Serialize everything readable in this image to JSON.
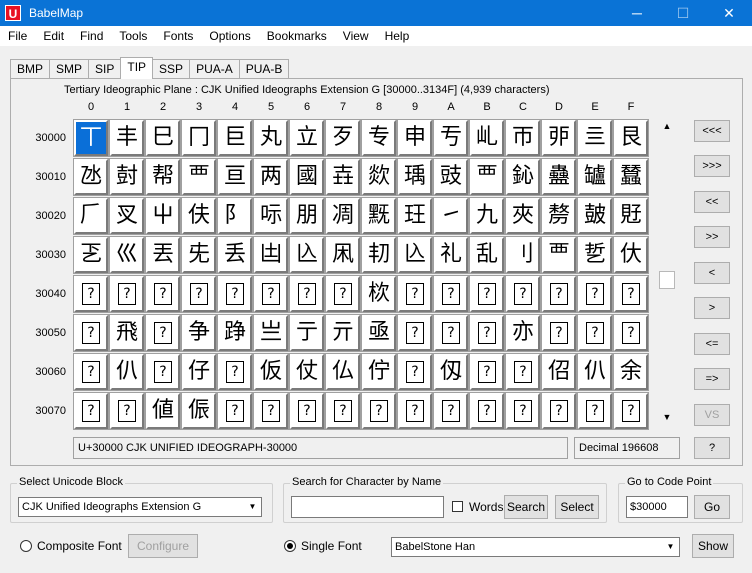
{
  "window": {
    "title": "BabelMap",
    "icon_letter": "U"
  },
  "window_controls": {
    "minimize": "─",
    "maximize": "☐",
    "close": "✕"
  },
  "menu": [
    "File",
    "Edit",
    "Find",
    "Tools",
    "Fonts",
    "Options",
    "Bookmarks",
    "View",
    "Help"
  ],
  "tabs": [
    "BMP",
    "SMP",
    "SIP",
    "TIP",
    "SSP",
    "PUA-A",
    "PUA-B"
  ],
  "active_tab": "TIP",
  "plane_title": "Tertiary Ideographic Plane : CJK Unified Ideographs Extension G [30000..3134F] (4,939 characters)",
  "grid": {
    "columns": [
      "0",
      "1",
      "2",
      "3",
      "4",
      "5",
      "6",
      "7",
      "8",
      "9",
      "A",
      "B",
      "C",
      "D",
      "E",
      "F"
    ],
    "rows": [
      {
        "label": "30000",
        "chars": [
          "丅",
          "丰",
          "巳",
          "冂",
          "巨",
          "丸",
          "立",
          "歹",
          "专",
          "申",
          "亐",
          "乢",
          "帀",
          "戼",
          "亖",
          "艮"
        ]
      },
      {
        "label": "30010",
        "chars": [
          "氹",
          "尌",
          "帮",
          "覀",
          "亘",
          "两",
          "國",
          "壵",
          "欻",
          "瑀",
          "豉",
          "覀",
          "鈊",
          "蠱",
          "罏",
          "蠺"
        ]
      },
      {
        "label": "30020",
        "chars": [
          "𠂆",
          "㕚",
          "屮",
          "伕",
          "阝",
          "呩",
          "朋",
          "凋",
          "黖",
          "玨",
          "㇀",
          "九",
          "夾",
          "剺",
          "皷",
          "覎"
        ]
      },
      {
        "label": "30030",
        "chars": [
          "乤",
          "巛",
          "丟",
          "兂",
          "丢",
          "凷",
          "兦",
          "凩",
          "㓞",
          "兦",
          "礼",
          "乱",
          "刂",
          "覀",
          "乴",
          "㐲"
        ]
      },
      {
        "label": "30040",
        "chars": [
          "?",
          "?",
          "?",
          "?",
          "?",
          "?",
          "?",
          "?",
          "栨",
          "?",
          "?",
          "?",
          "?",
          "?",
          "?",
          "?"
        ]
      },
      {
        "label": "30050",
        "chars": [
          "?",
          "飛",
          "?",
          "争",
          "踭",
          "亗",
          "亍",
          "亓",
          "亟",
          "?",
          "?",
          "?",
          "亦",
          "?",
          "?",
          "?"
        ]
      },
      {
        "label": "30060",
        "chars": [
          "?",
          "仈",
          "?",
          "仔",
          "?",
          "仮",
          "仗",
          "仏",
          "佇",
          "?",
          "仭",
          "?",
          "?",
          "佋",
          "仈",
          "余"
        ]
      },
      {
        "label": "30070",
        "chars": [
          "?",
          "?",
          "値",
          "侲",
          "?",
          "?",
          "?",
          "?",
          "?",
          "?",
          "?",
          "?",
          "?",
          "?",
          "?",
          "?"
        ]
      }
    ],
    "selected": "30000"
  },
  "nav_buttons": [
    "<<<",
    ">>>",
    "<<",
    ">>",
    "<",
    ">",
    "<=",
    "=>",
    "VS",
    "?"
  ],
  "status": {
    "char_info": "U+30000 CJK UNIFIED IDEOGRAPH-30000",
    "decimal": "Decimal 196608"
  },
  "unicode_block": {
    "label": "Select Unicode Block",
    "value": "CJK Unified Ideographs Extension G"
  },
  "search": {
    "label": "Search for Character by Name",
    "value": "",
    "words_label": "Words",
    "search_btn": "Search",
    "select_btn": "Select"
  },
  "goto": {
    "label": "Go to Code Point",
    "value": "$30000",
    "go_btn": "Go"
  },
  "font": {
    "composite_label": "Composite Font",
    "configure_btn": "Configure",
    "single_label": "Single Font",
    "font_name": "BabelStone Han",
    "show_btn": "Show"
  }
}
